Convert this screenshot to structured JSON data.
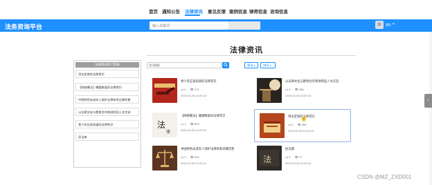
{
  "nav": {
    "items": [
      {
        "label": "首页"
      },
      {
        "label": "通知公告"
      },
      {
        "label": "法律资讯"
      },
      {
        "label": "意见反馈"
      },
      {
        "label": "案例信息"
      },
      {
        "label": "律师信息"
      },
      {
        "label": "咨询信息"
      }
    ],
    "active_index": 2
  },
  "header": {
    "brand": "法务资询平台",
    "search_placeholder": "输入关键词",
    "user_name": "林5",
    "user_chevron": "▾"
  },
  "page": {
    "title": "法律资讯"
  },
  "sidebar": {
    "header": "法律资讯热门列表",
    "items": [
      {
        "label": "用法定商的法律常识"
      },
      {
        "label": "【网络暴法】播媒数值风法律常识"
      },
      {
        "label": "中国特色未成年人保护法律体系日臻完善"
      },
      {
        "label": "以法律文化与教育合作增进明亚人文交流"
      },
      {
        "label": "青少年应该知道的法律常识"
      },
      {
        "label": "民法典"
      }
    ]
  },
  "filter": {
    "placeholder": "资讯搜索",
    "dropdown_1": "筛选 ▾",
    "dropdown_2": "排序 ▾"
  },
  "cards": [
    {
      "title": "青少年应该知道的法律常识",
      "likes": "0",
      "views": "171",
      "date": "2024-02-28 14:20:13",
      "thumb": "thumb-gavel-red"
    },
    {
      "title": "以法律文化与教育合作增进明亚人文交流",
      "likes": "0",
      "views": "486",
      "date": "2024-02-28 14:20:13",
      "thumb": "thumb-statue-dark"
    },
    {
      "title": "【网络暴法】播媒数值风法律常识",
      "likes": "1",
      "views": "623",
      "date": "2024-02-28 14:20:13",
      "thumb": "thumb-law-text"
    },
    {
      "title": "用法定商的法律常识",
      "likes": "0",
      "views": "366",
      "date": "2024-02-28 14:20:13",
      "thumb": "thumb-book-red"
    },
    {
      "title": "中国特色未成年人保护法律体系日臻完善",
      "likes": "0",
      "views": "510",
      "date": "2024-02-28 14:20:13",
      "thumb": "thumb-scales-brown"
    },
    {
      "title": "民法典",
      "likes": "0",
      "views": "17",
      "date": "2024-02-28 14:20:13",
      "thumb": "thumb-calligraphy"
    }
  ],
  "colors": {
    "accent": "#1890ff",
    "bar": "#1e90ff"
  },
  "side_tab": "‹",
  "watermark": "CSDN @MZ_ZXD001"
}
